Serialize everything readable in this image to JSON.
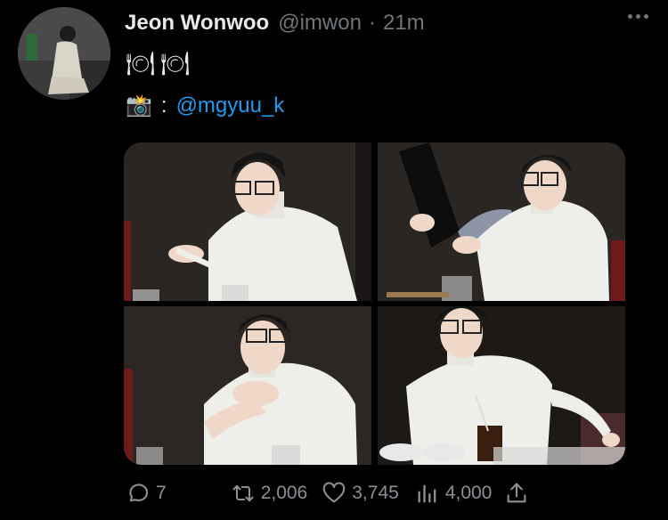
{
  "tweet": {
    "author_name": "Jeon Wonwoo",
    "handle": "@imwon",
    "separator": "·",
    "time": "21m",
    "line1_emoji": [
      "🍽",
      "🍽"
    ],
    "camera_emoji": "📸",
    "colon": ":",
    "mention": "@mgyuu_k"
  },
  "actions": {
    "reply_count": "7",
    "retweet_count": "2,006",
    "like_count": "3,745",
    "views_count": "4,000"
  },
  "icons": {
    "reply": "reply-icon",
    "retweet": "retweet-icon",
    "like": "heart-icon",
    "views": "views-icon",
    "share": "share-icon",
    "more": "more-icon"
  },
  "colors": {
    "background": "#000000",
    "text": "#e7e9ea",
    "secondary": "#71767b",
    "link": "#1d9bf0"
  }
}
